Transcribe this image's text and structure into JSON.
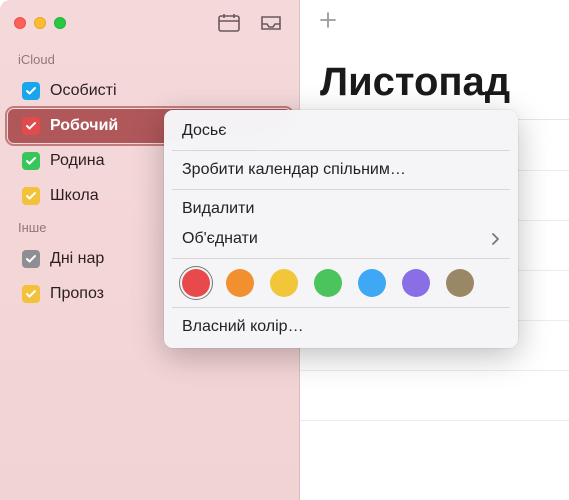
{
  "sidebar": {
    "sections": [
      {
        "header": "iCloud",
        "items": [
          {
            "label": "Особисті",
            "color": "#1aa6ea",
            "selected": false
          },
          {
            "label": "Робочий",
            "color": "#e14b4e",
            "selected": true
          },
          {
            "label": "Родина",
            "color": "#38c65a",
            "selected": false
          },
          {
            "label": "Школа",
            "color": "#f3c23a",
            "selected": false
          }
        ]
      },
      {
        "header": "Інше",
        "items": [
          {
            "label": "Дні нар",
            "color": "#8e8e93",
            "selected": false
          },
          {
            "label": "Пропоз",
            "color": "#f3c23a",
            "selected": false
          }
        ]
      }
    ]
  },
  "main": {
    "title": "Листопад"
  },
  "context_menu": {
    "items": {
      "info": "Досьє",
      "share": "Зробити календар спільним…",
      "delete": "Видалити",
      "merge": "Об'єднати",
      "custom_color": "Власний колір…"
    },
    "colors": [
      {
        "hex": "#e8494c",
        "selected": true
      },
      {
        "hex": "#f0902e",
        "selected": false
      },
      {
        "hex": "#f1c739",
        "selected": false
      },
      {
        "hex": "#4cc45d",
        "selected": false
      },
      {
        "hex": "#3fa8f4",
        "selected": false
      },
      {
        "hex": "#8a6ee6",
        "selected": false
      },
      {
        "hex": "#9a8765",
        "selected": false
      }
    ]
  }
}
